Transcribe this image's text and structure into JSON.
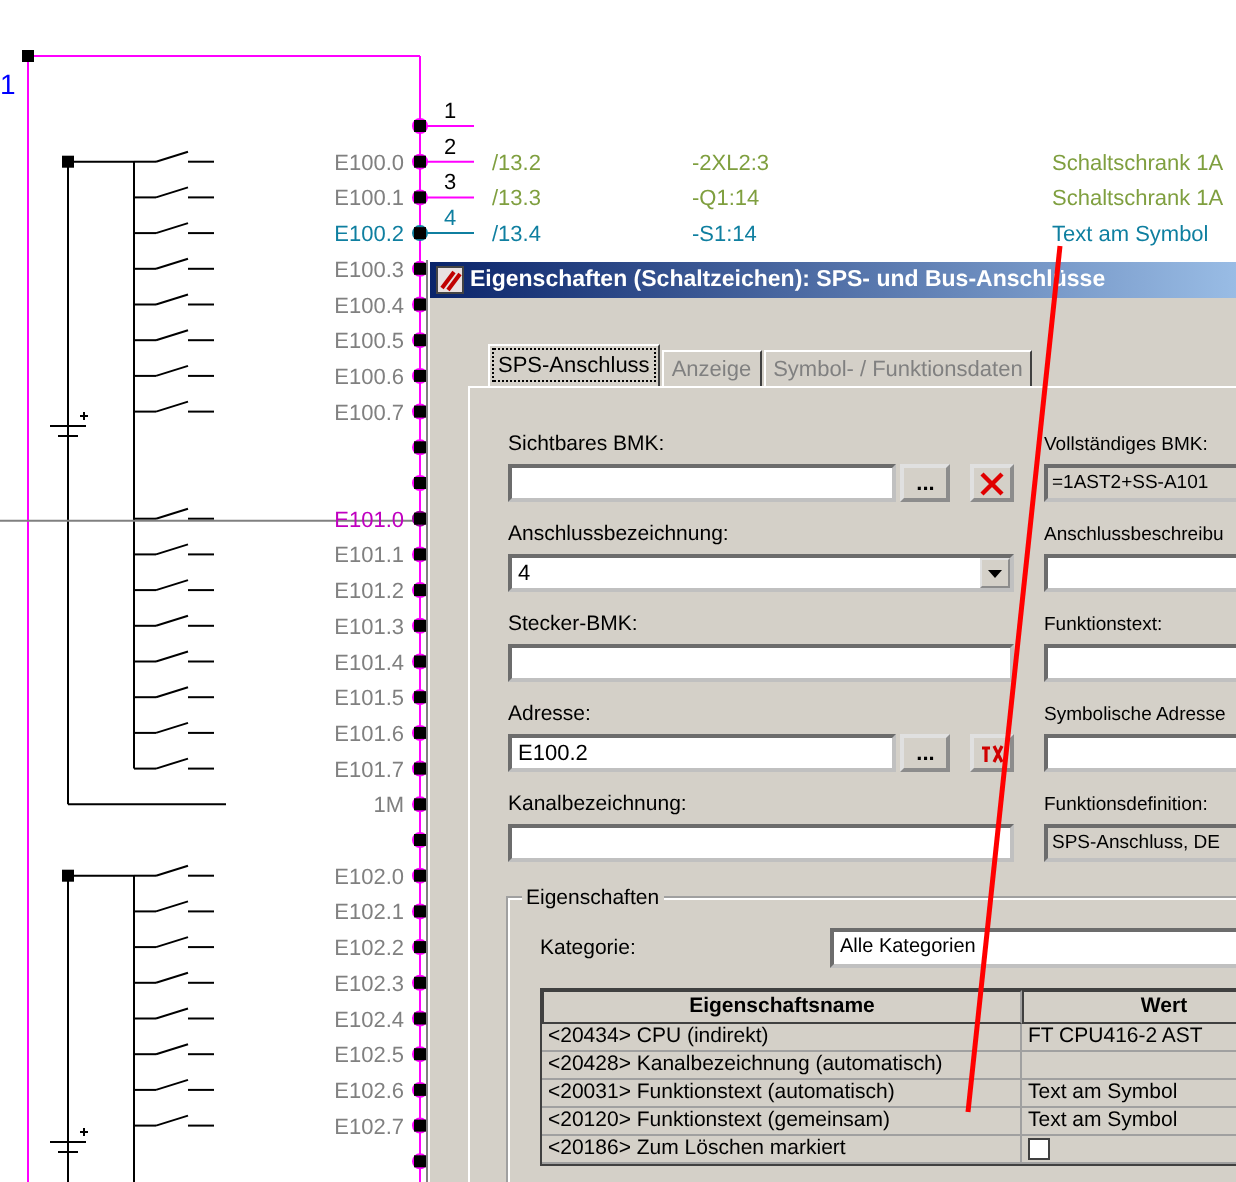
{
  "schematic": {
    "sheet_marker": "1",
    "pin_numbers": [
      {
        "label": "1",
        "selected": false
      },
      {
        "label": "2",
        "selected": false
      },
      {
        "label": "3",
        "selected": false
      },
      {
        "label": "4",
        "selected": true
      }
    ],
    "cross_references": [
      {
        "page_ref": "/13.2",
        "device": "-2XL2:3",
        "function": "Schaltschrank 1A",
        "selected": false
      },
      {
        "page_ref": "/13.3",
        "device": "-Q1:14",
        "function": "Schaltschrank 1A",
        "selected": false
      },
      {
        "page_ref": "/13.4",
        "device": "-S1:14",
        "function": "Text am Symbol",
        "selected": true
      }
    ],
    "terminals": [
      {
        "kind": "blank",
        "selected": false,
        "hovered": false
      },
      {
        "kind": "input",
        "label": "E100.0",
        "selected": false,
        "hovered": false
      },
      {
        "kind": "input",
        "label": "E100.1",
        "selected": false,
        "hovered": false
      },
      {
        "kind": "input",
        "label": "E100.2",
        "selected": true,
        "hovered": false
      },
      {
        "kind": "input",
        "label": "E100.3",
        "selected": false,
        "hovered": false
      },
      {
        "kind": "input",
        "label": "E100.4",
        "selected": false,
        "hovered": false
      },
      {
        "kind": "input",
        "label": "E100.5",
        "selected": false,
        "hovered": false
      },
      {
        "kind": "input",
        "label": "E100.6",
        "selected": false,
        "hovered": false
      },
      {
        "kind": "input",
        "label": "E100.7",
        "selected": false,
        "hovered": false
      },
      {
        "kind": "blank",
        "selected": false,
        "hovered": false
      },
      {
        "kind": "blank",
        "selected": false,
        "hovered": false
      },
      {
        "kind": "input",
        "label": "E101.0",
        "selected": false,
        "hovered": true
      },
      {
        "kind": "input",
        "label": "E101.1",
        "selected": false,
        "hovered": false
      },
      {
        "kind": "input",
        "label": "E101.2",
        "selected": false,
        "hovered": false
      },
      {
        "kind": "input",
        "label": "E101.3",
        "selected": false,
        "hovered": false
      },
      {
        "kind": "input",
        "label": "E101.4",
        "selected": false,
        "hovered": false
      },
      {
        "kind": "input",
        "label": "E101.5",
        "selected": false,
        "hovered": false
      },
      {
        "kind": "input",
        "label": "E101.6",
        "selected": false,
        "hovered": false
      },
      {
        "kind": "input",
        "label": "E101.7",
        "selected": false,
        "hovered": false
      },
      {
        "kind": "common",
        "label": "1M",
        "selected": false,
        "hovered": false
      },
      {
        "kind": "blank",
        "selected": false,
        "hovered": false
      },
      {
        "kind": "input",
        "label": "E102.0",
        "selected": false,
        "hovered": false
      },
      {
        "kind": "input",
        "label": "E102.1",
        "selected": false,
        "hovered": false
      },
      {
        "kind": "input",
        "label": "E102.2",
        "selected": false,
        "hovered": false
      },
      {
        "kind": "input",
        "label": "E102.3",
        "selected": false,
        "hovered": false
      },
      {
        "kind": "input",
        "label": "E102.4",
        "selected": false,
        "hovered": false
      },
      {
        "kind": "input",
        "label": "E102.5",
        "selected": false,
        "hovered": false
      },
      {
        "kind": "input",
        "label": "E102.6",
        "selected": false,
        "hovered": false
      },
      {
        "kind": "input",
        "label": "E102.7",
        "selected": false,
        "hovered": false
      },
      {
        "kind": "blank",
        "selected": false,
        "hovered": false
      }
    ]
  },
  "dialog": {
    "title": "Eigenschaften (Schaltzeichen): SPS- und Bus-Anschlüsse",
    "tabs": [
      {
        "label": "SPS-Anschluss",
        "selected": true
      },
      {
        "label": "Anzeige",
        "selected": false
      },
      {
        "label": "Symbol- / Funktionsdaten",
        "selected": false
      }
    ],
    "left_fields": [
      {
        "kind": "text_with_buttons",
        "label": "Sichtbares BMK:",
        "buttons": [
          {
            "kind": "browse",
            "label": "..."
          },
          {
            "kind": "clear"
          }
        ]
      },
      {
        "kind": "dropdown",
        "label": "Anschlussbezeichnung:",
        "value": "4"
      },
      {
        "kind": "text",
        "label": "Stecker-BMK:"
      },
      {
        "kind": "text_with_buttons",
        "label": "Adresse:",
        "value": "E100.2",
        "buttons": [
          {
            "kind": "browse",
            "label": "..."
          },
          {
            "kind": "symbol"
          }
        ]
      },
      {
        "kind": "text",
        "label": "Kanalbezeichnung:"
      }
    ],
    "right_fields": [
      {
        "label": "Vollständiges BMK:",
        "value": "=1AST2+SS-A101",
        "disabled": true
      },
      {
        "label": "Anschlussbeschreibu",
        "disabled": false
      },
      {
        "label": "Funktionstext:",
        "disabled": false
      },
      {
        "label": "Symbolische Adresse",
        "disabled": false
      },
      {
        "label": "Funktionsdefinition:",
        "value": "SPS-Anschluss, DE",
        "disabled": true
      }
    ],
    "properties": {
      "title": "Eigenschaften",
      "category_label": "Kategorie:",
      "category": "Alle Kategorien",
      "columns": [
        "Eigenschaftsname",
        "Wert"
      ],
      "rows": [
        {
          "kind": "text",
          "name": "<20434> CPU (indirekt)",
          "value": "FT CPU416-2 AST"
        },
        {
          "kind": "text",
          "name": "<20428> Kanalbezeichnung (automatisch)"
        },
        {
          "kind": "text",
          "name": "<20031> Funktionstext (automatisch)",
          "value": "Text am Symbol"
        },
        {
          "kind": "text",
          "name": "<20120> Funktionstext (gemeinsam)",
          "value": "Text am Symbol"
        },
        {
          "kind": "checkbox",
          "name": "<20186> Zum Löschen markiert",
          "checked": false
        }
      ]
    }
  }
}
